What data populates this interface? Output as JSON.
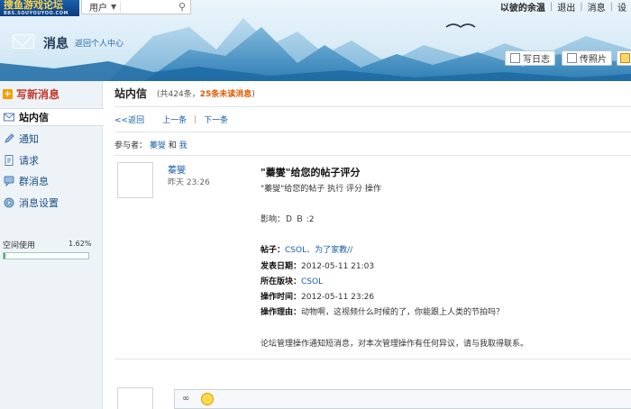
{
  "header": {
    "logo_title": "搜鱼游戏论坛",
    "logo_sub": "BBS.SOUYOUYOO.COM",
    "user_select_label": "用户",
    "top_links": [
      "以彼的余温",
      "退出",
      "消息",
      "设"
    ],
    "page_name": "消息",
    "back_link": "返回个人中心",
    "buttons": {
      "write_log": "写日志",
      "upload_photo": "传照片"
    }
  },
  "sidebar": {
    "compose_label": "写新消息",
    "items": [
      {
        "label": "站内信",
        "icon": "envelope-icon"
      },
      {
        "label": "通知",
        "icon": "pencil-icon"
      },
      {
        "label": "请求",
        "icon": "page-icon"
      },
      {
        "label": "群消息",
        "icon": "chat-icon"
      },
      {
        "label": "消息设置",
        "icon": "gear-icon"
      }
    ],
    "space_label": "空间使用",
    "space_percent": "1.62%",
    "space_fraction": 0.0162
  },
  "main": {
    "title": "站内信",
    "count_prefix": "(共424条，",
    "unread": "25条未读消息",
    "count_suffix": ")",
    "nav": {
      "back": "<<返回",
      "prev": "上一条",
      "next": "下一条"
    },
    "participants_prefix": "参与者：",
    "participant_name": "蓁燮",
    "participants_and": "和",
    "participant_me": "我",
    "sender": "蓁燮",
    "time": "昨天 23:26",
    "subject": "\"蓁燮\"给您的帖子评分",
    "summary": "\"蓁燮\"给您的帖子 执行 评分 操作",
    "effect": "影响：Ｄ Ｂ :2",
    "post_label": "帖子：",
    "post_value": "CSOL、为了家教//",
    "date_label": "发表日期：",
    "date_value": "2012-05-11 21:03",
    "forum_label": "所在版块：",
    "forum_value": "CSOL",
    "optime_label": "操作时间：",
    "optime_value": "2012-05-11 23:26",
    "reason_label": "操作理由：",
    "reason_value": "动物啊，这视频什么时候的了，你能跟上人类的节拍吗？",
    "footer": "论坛管理操作通知短消息，对本次管理操作有任何异议，请与我取得联系。"
  }
}
